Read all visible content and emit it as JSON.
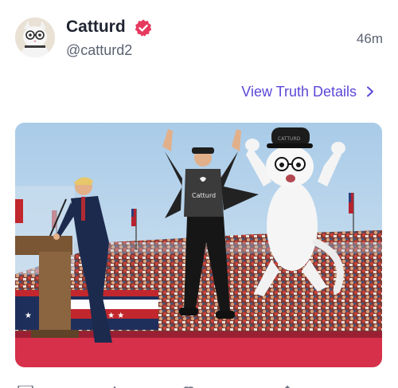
{
  "post": {
    "author": {
      "display_name": "Catturd",
      "handle": "@catturd2",
      "verified": true,
      "avatar_icon": "cat-with-glasses-avatar"
    },
    "timestamp": "46m",
    "details_link": "View Truth Details",
    "image": {
      "shirt_text": "Catturd",
      "cap_text": "CATTURD"
    }
  },
  "colors": {
    "accent": "#5b48d8",
    "verified_badge": "#e6395f",
    "name_text": "#1f2430",
    "secondary_text": "#5b6272"
  },
  "icons": {
    "verified": "verified-badge-icon",
    "chevron": "chevron-right-icon"
  }
}
